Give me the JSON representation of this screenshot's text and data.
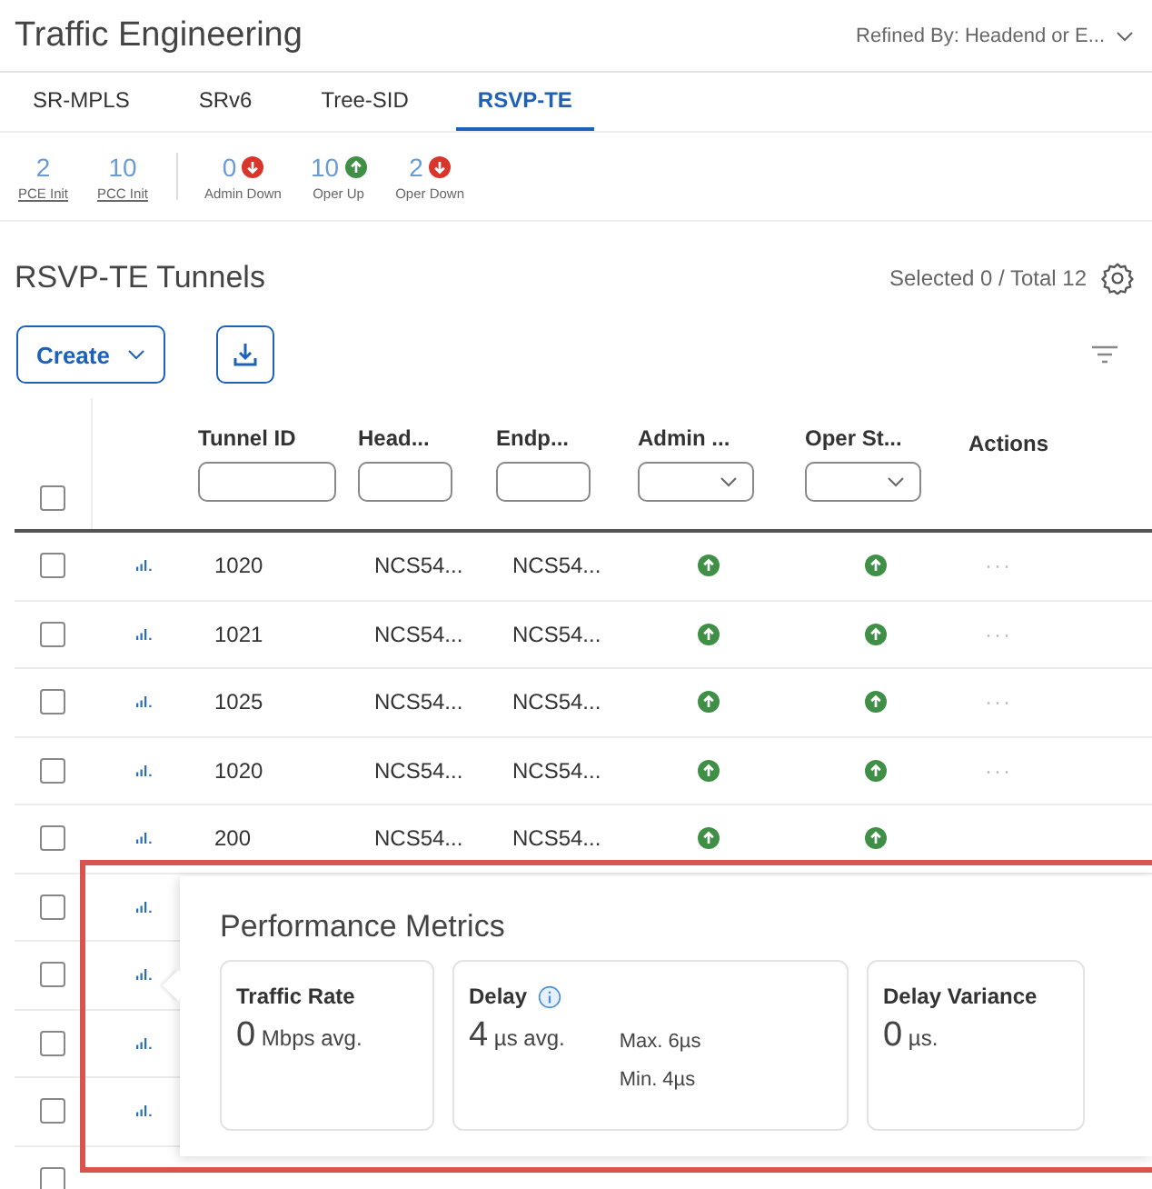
{
  "header": {
    "title": "Traffic Engineering",
    "filter": "Refined By: Headend or E..."
  },
  "tabs": [
    {
      "label": "SR-MPLS",
      "selected": false
    },
    {
      "label": "SRv6",
      "selected": false
    },
    {
      "label": "Tree-SID",
      "selected": false
    },
    {
      "label": "RSVP-TE",
      "selected": true
    }
  ],
  "stats": [
    {
      "kind": "link",
      "value": "2",
      "label": "PCE Init"
    },
    {
      "kind": "link",
      "value": "10",
      "label": "PCC Init"
    },
    {
      "kind": "status",
      "value": "0",
      "label": "Admin Down",
      "up": false
    },
    {
      "kind": "status",
      "value": "10",
      "label": "Oper Up",
      "up": true
    },
    {
      "kind": "status",
      "value": "2",
      "label": "Oper Down",
      "up": false
    }
  ],
  "section": {
    "title": "RSVP-TE Tunnels",
    "summary": "Selected 0 / Total 12"
  },
  "toolbar": {
    "create": "Create"
  },
  "table": {
    "columns": [
      {
        "label": "Tunnel ID",
        "kind": "text"
      },
      {
        "label": "Head...",
        "kind": "text"
      },
      {
        "label": "Endp...",
        "kind": "text"
      },
      {
        "label": "Admin ...",
        "kind": "select"
      },
      {
        "label": "Oper St...",
        "kind": "select"
      },
      {
        "label": "Actions",
        "kind": "plain"
      }
    ],
    "header_checked": false,
    "rows": [
      {
        "checked": false,
        "metrics": true,
        "id": "1020",
        "headend": "NCS54...",
        "endpoint": "NCS54...",
        "admin_up": true,
        "oper_up": true,
        "actions": "···"
      },
      {
        "checked": false,
        "metrics": true,
        "id": "1021",
        "headend": "NCS54...",
        "endpoint": "NCS54...",
        "admin_up": true,
        "oper_up": true,
        "actions": "···"
      },
      {
        "checked": false,
        "metrics": true,
        "id": "1025",
        "headend": "NCS54...",
        "endpoint": "NCS54...",
        "admin_up": true,
        "oper_up": true,
        "actions": "···"
      },
      {
        "checked": false,
        "metrics": true,
        "id": "1020",
        "headend": "NCS54...",
        "endpoint": "NCS54...",
        "admin_up": true,
        "oper_up": true,
        "actions": "···"
      },
      {
        "checked": false,
        "metrics": true,
        "id": "200",
        "headend": "NCS54...",
        "endpoint": "NCS54...",
        "admin_up": true,
        "oper_up": true
      },
      {
        "checked": false,
        "metrics": true
      },
      {
        "checked": false,
        "metrics": true
      },
      {
        "checked": false,
        "metrics": true
      },
      {
        "checked": false,
        "metrics": true
      },
      {
        "checked": false,
        "metrics": false
      }
    ]
  },
  "popover": {
    "title": "Performance Metrics",
    "cards": [
      {
        "title": "Traffic Rate",
        "value": "0",
        "unit": "Mbps avg.",
        "info": false
      },
      {
        "title": "Delay",
        "value": "4",
        "unit": "µs avg.",
        "info": true,
        "max": "Max. 6µs",
        "min": "Min. 4µs"
      },
      {
        "title": "Delay Variance",
        "value": "0",
        "unit": "µs.",
        "info": false
      }
    ]
  }
}
